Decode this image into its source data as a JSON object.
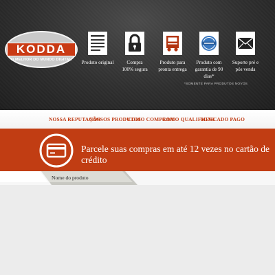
{
  "logo": {
    "name": "KODDA",
    "tagline": "O MELHOR DO MUNDO DIGITAL"
  },
  "features": [
    {
      "icon": "document-icon",
      "label": "Produto original"
    },
    {
      "icon": "padlock-icon",
      "label": "Compra\n100% segura"
    },
    {
      "icon": "truck-icon",
      "label": "Produto para\npronta entrega"
    },
    {
      "icon": "guarantee-seal-icon",
      "label": "Produto com\ngarantia de 90 dias*"
    },
    {
      "icon": "envelope-icon",
      "label": "Suporte pré e\npós venda"
    }
  ],
  "footnote": "*SOMENTE PARA PRODUTOS NOVOS",
  "nav": [
    "NOSSA REPUTAÇÃO",
    "NOSSOS PRODUTOS",
    "COMO COMPRAR",
    "COMO QUALIFICAR",
    "MERCADO PAGO"
  ],
  "banner": {
    "icon": "credit-card-icon",
    "text": "Parcele suas compras em até 12 vezes no cartão de crédito"
  },
  "product_tab": {
    "label": "Nome do produto"
  },
  "colors": {
    "accent": "#c13d13",
    "header_bg": "#2e2e2e",
    "nav_text": "#c03a12",
    "page_bg": "#ececec"
  }
}
